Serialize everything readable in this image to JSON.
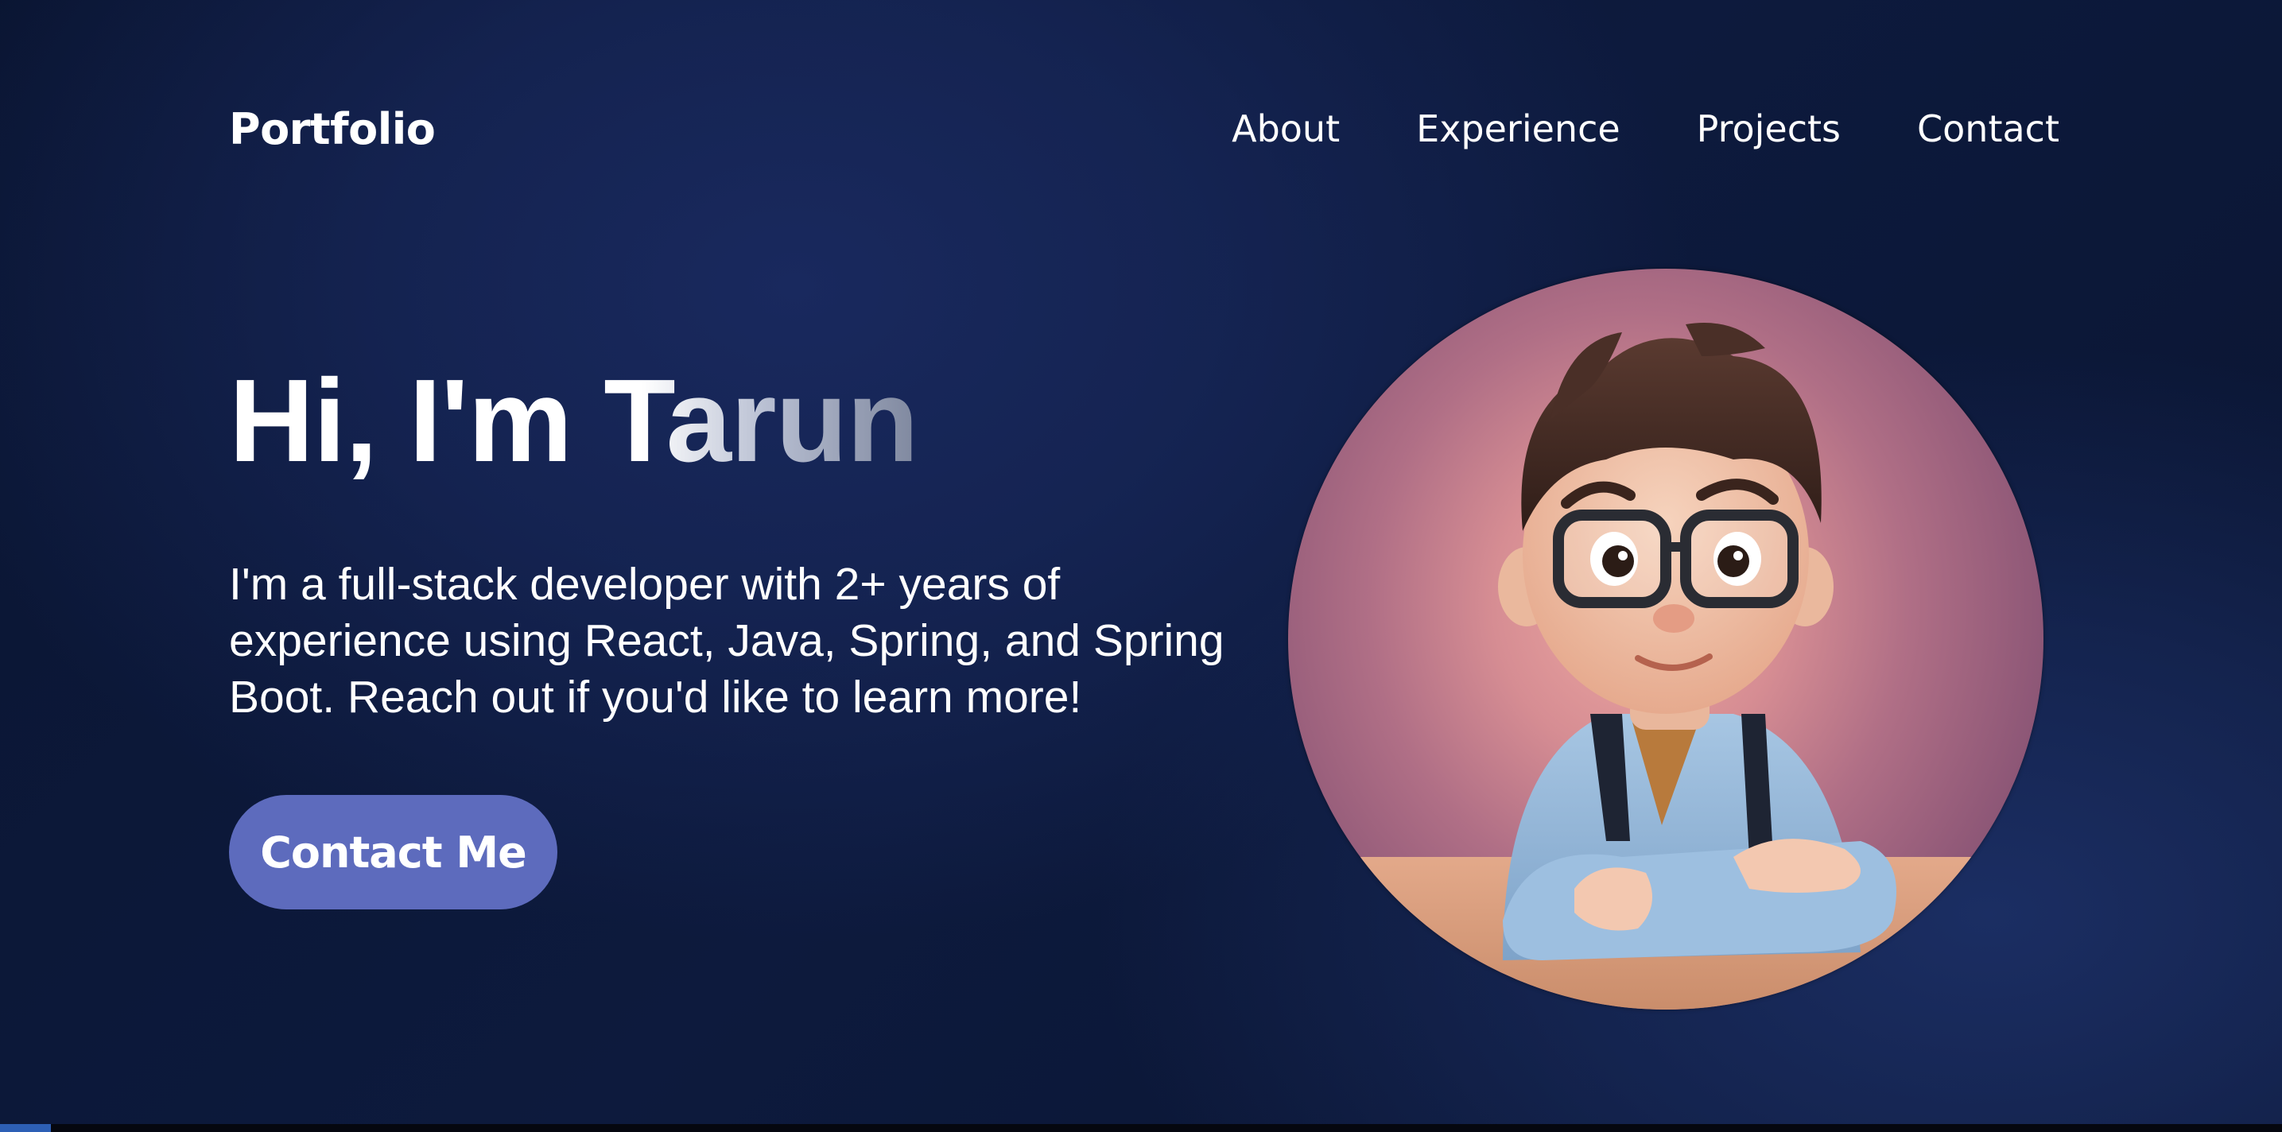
{
  "nav": {
    "logo": "Portfolio",
    "links": [
      {
        "label": "About"
      },
      {
        "label": "Experience"
      },
      {
        "label": "Projects"
      },
      {
        "label": "Contact"
      }
    ]
  },
  "hero": {
    "title": "Hi, I'm Tarun",
    "description": "I'm a full-stack developer with 2+ years of experience using React, Java, Spring, and Spring Boot. Reach out if you'd like to learn more!",
    "cta_label": "Contact Me"
  },
  "avatar": {
    "icon": "cartoon-developer-avatar"
  },
  "colors": {
    "background": "#0b1530",
    "accent_button": "#5d6bbd",
    "text": "#ffffff",
    "avatar_bg": "#d68d93"
  }
}
